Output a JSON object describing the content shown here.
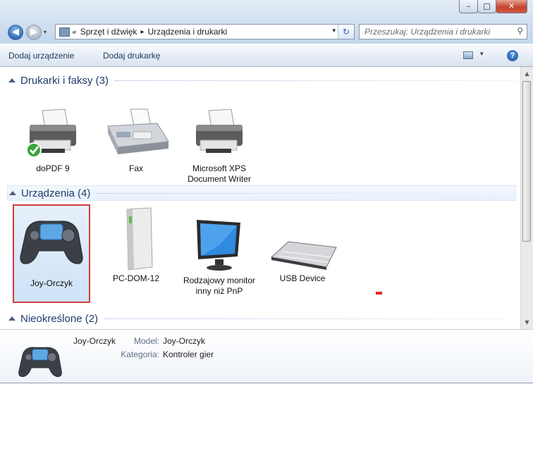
{
  "window": {
    "min": "–",
    "max": "□",
    "close": "✕"
  },
  "nav": {
    "back": "◀",
    "forward": "▶",
    "dropdown": "▾"
  },
  "address": {
    "overflow": "«",
    "crumbs": [
      "Sprzęt i dźwięk",
      "Urządzenia i drukarki"
    ],
    "sep": "▸",
    "dropdown": "▾",
    "refresh": "↻"
  },
  "search": {
    "placeholder": "Przeszukaj: Urządzenia i drukarki",
    "icon": "⚲"
  },
  "toolbar": {
    "add_device": "Dodaj urządzenie",
    "add_printer": "Dodaj drukarkę",
    "view_dropdown": "▾",
    "help": "?"
  },
  "groups": {
    "printers": {
      "label": "Drukarki i faksy (3)",
      "items": [
        {
          "label": "doPDF 9",
          "icon": "printer-default-icon"
        },
        {
          "label": "Fax",
          "icon": "fax-icon"
        },
        {
          "label": "Microsoft XPS Document Writer",
          "icon": "printer-icon"
        }
      ]
    },
    "devices": {
      "label": "Urządzenia (4)",
      "items": [
        {
          "label": "Joy-Orczyk",
          "icon": "gamepad-icon",
          "selected": true
        },
        {
          "label": "PC-DOM-12",
          "icon": "computer-icon"
        },
        {
          "label": "Rodzajowy monitor inny niż PnP",
          "icon": "monitor-icon"
        },
        {
          "label": "USB Device",
          "icon": "keyboard-icon"
        }
      ]
    },
    "unspecified": {
      "label": "Nieokreślone (2)"
    }
  },
  "details": {
    "name": "Joy-Orczyk",
    "model_label": "Model:",
    "model_value": "Joy-Orczyk",
    "category_label": "Kategoria:",
    "category_value": "Kontroler gier"
  },
  "scrollbar": {
    "up": "▲",
    "down": "▼"
  },
  "colors": {
    "selection_border": "#d13c3c",
    "group_text": "#1e3c6e",
    "accent": "#2d6ab7"
  }
}
